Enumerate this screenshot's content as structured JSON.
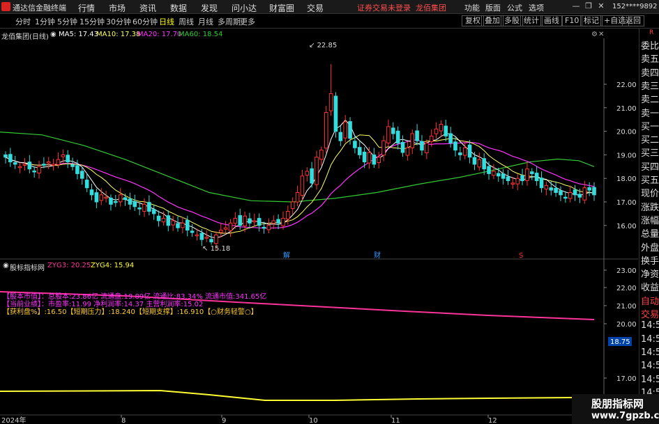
{
  "menubar": {
    "app_name": "通达信金融终端",
    "items": [
      "行情",
      "市场",
      "资讯",
      "数据",
      "发现",
      "问小达",
      "财富圈",
      "交易"
    ],
    "status": "证券交易未登录",
    "status_stock": "龙佰集团",
    "right_items": [
      "功能",
      "版面",
      "公式",
      "选项"
    ],
    "user": "152****9892"
  },
  "periodbar": {
    "periods": [
      "分时",
      "1分钟",
      "5分钟",
      "15分钟",
      "30分钟",
      "60分钟",
      "日线",
      "周线",
      "月线",
      "多周期",
      "更多"
    ],
    "active": "日线",
    "tools": [
      "复权",
      "叠加",
      "多股",
      "统计",
      "画线",
      "F10",
      "标记",
      "+自选",
      "返回"
    ]
  },
  "main_chart": {
    "stock_title": "龙佰集团(日线)",
    "ma_labels": [
      "MA5: 17.43",
      "MA10: 17.38",
      "MA20: 17.70",
      "MA60: 18.54"
    ],
    "high_label": "22.85",
    "low_label": "15.18",
    "y_ticks": [
      "22.00",
      "21.00",
      "20.00",
      "19.00",
      "18.00",
      "17.00",
      "16.00"
    ],
    "markers": [
      "解",
      "财"
    ]
  },
  "sub_chart": {
    "title": "股标指标网",
    "zyg3": "ZYG3: 20.25",
    "zyg4": "ZYG4: 15.94",
    "info_lines": [
      "【股本市值】：总股本:23.86亿  流通盘:19.89亿  流通比:83.34%  流通市值:341.65亿",
      "【当前业绩】：市盈率:11.99  净利润率:14.37  主营利润率:15.02",
      "【获利盘%】:16.50【短期压力】:18.240【短期支撑】:16.910【○财务轻警○】"
    ],
    "y_ticks": [
      "23.00",
      "22.00",
      "21.00",
      "20.00",
      "18.75",
      "17.00"
    ],
    "current_value": "18.75"
  },
  "x_axis": {
    "labels": [
      "2024年",
      "8",
      "9",
      "10",
      "11",
      "12"
    ]
  },
  "right_panel": {
    "items": [
      "委比",
      "卖五",
      "卖四",
      "卖三",
      "卖二",
      "卖一",
      "买一",
      "买二",
      "买三",
      "买四",
      "买五",
      "现价",
      "涨跌",
      "涨幅",
      "总量",
      "外盘",
      "换手",
      "净资",
      "收益",
      "自动",
      "交易",
      "14:5",
      "14:5",
      "14:5",
      "14:5",
      "14:5",
      "14:5",
      "14:5",
      "14:5"
    ]
  },
  "watermark": {
    "line1": "股朋指标网",
    "line2": "www.7gpzb.com"
  },
  "colors": {
    "up": "#ff3333",
    "down": "#33dddd",
    "ma5": "#ffffff",
    "ma10": "#ffff66",
    "ma20": "#ff33ff",
    "ma60": "#33cc33"
  }
}
